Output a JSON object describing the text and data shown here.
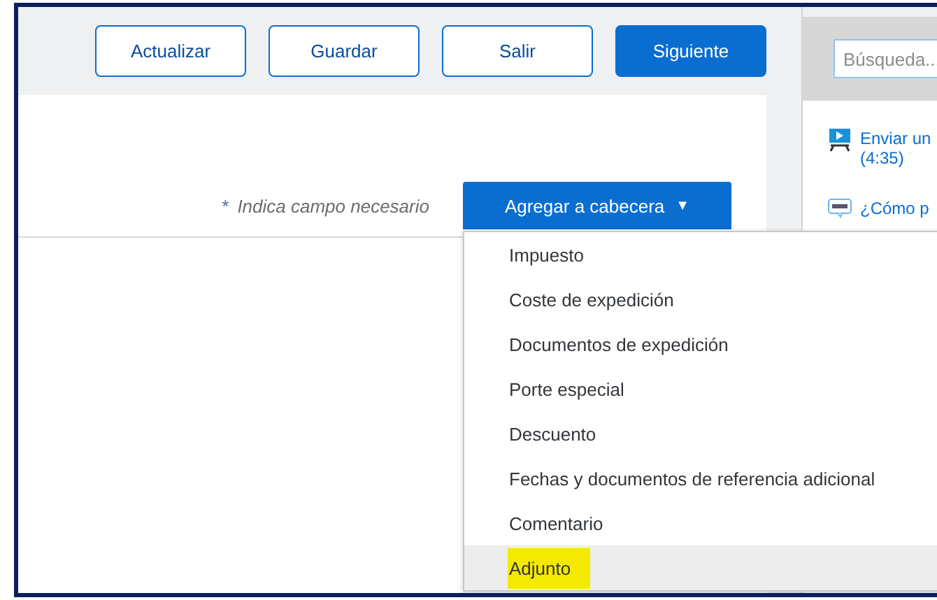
{
  "toolbar": {
    "buttons": [
      {
        "label": "Actualizar",
        "primary": false
      },
      {
        "label": "Guardar",
        "primary": false
      },
      {
        "label": "Salir",
        "primary": false
      },
      {
        "label": "Siguiente",
        "primary": true
      }
    ]
  },
  "header": {
    "required_mark": "*",
    "required_note": "Indica campo necesario",
    "add_button": {
      "label": "Agregar a cabecera",
      "caret": "▼"
    }
  },
  "menu": {
    "items": [
      {
        "label": "Impuesto",
        "selected": false,
        "marked": false
      },
      {
        "label": "Coste de expedición",
        "selected": false,
        "marked": false
      },
      {
        "label": "Documentos de expedición",
        "selected": false,
        "marked": false
      },
      {
        "label": "Porte especial",
        "selected": false,
        "marked": false
      },
      {
        "label": "Descuento",
        "selected": false,
        "marked": false
      },
      {
        "label": "Fechas y documentos de referencia adicional",
        "selected": false,
        "marked": false
      },
      {
        "label": "Comentario",
        "selected": false,
        "marked": false
      },
      {
        "label": "Adjunto",
        "selected": true,
        "marked": true
      }
    ]
  },
  "sidebar": {
    "search": {
      "placeholder": "Búsqueda..."
    },
    "links": [
      {
        "kind": "video",
        "lines": [
          "Enviar un",
          "(4:35)"
        ]
      },
      {
        "kind": "faq",
        "lines": [
          "¿Cómo p"
        ]
      }
    ]
  }
}
